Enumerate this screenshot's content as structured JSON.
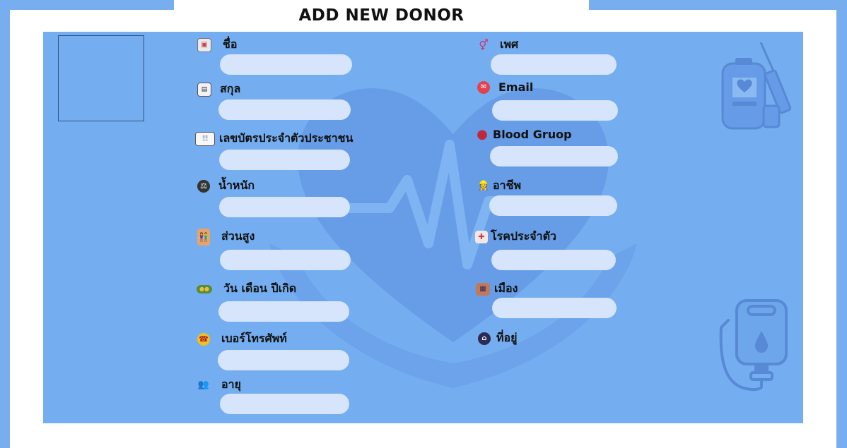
{
  "header": {
    "title": "ADD NEW DONOR"
  },
  "left_fields": [
    {
      "label": "ชื่อ",
      "icon": "id-badge-icon",
      "value": "",
      "placeholder": ""
    },
    {
      "label": "สกุล",
      "icon": "id-card-icon",
      "value": "",
      "placeholder": ""
    },
    {
      "label": "เลขบัตรประจำตัวประชาชน",
      "icon": "citizen-card-icon",
      "value": "",
      "placeholder": ""
    },
    {
      "label": "น้ำหนัก",
      "icon": "weight-scale-icon",
      "value": "",
      "placeholder": ""
    },
    {
      "label": "ส่วนสูง",
      "icon": "people-height-icon",
      "value": "",
      "placeholder": ""
    },
    {
      "label": "วัน เดือน ปีเกิด",
      "icon": "birthday-icon",
      "value": "",
      "placeholder": ""
    },
    {
      "label": "เบอร์โทรศัพท์",
      "icon": "phone-icon",
      "value": "",
      "placeholder": ""
    },
    {
      "label": "อายุ",
      "icon": "age-people-icon",
      "value": "",
      "placeholder": ""
    }
  ],
  "right_fields": [
    {
      "label": "เพศ",
      "icon": "gender-icon",
      "value": "",
      "placeholder": ""
    },
    {
      "label": "Email",
      "icon": "email-icon",
      "value": "",
      "placeholder": ""
    },
    {
      "label": "Blood Gruop",
      "icon": "blood-drop-icon",
      "value": "",
      "placeholder": ""
    },
    {
      "label": "อาชีพ",
      "icon": "occupation-icon",
      "value": "",
      "placeholder": ""
    },
    {
      "label": "โรคประจำตัว",
      "icon": "medical-condition-icon",
      "value": "",
      "placeholder": ""
    },
    {
      "label": "เมือง",
      "icon": "city-icon",
      "value": "",
      "placeholder": ""
    },
    {
      "label": "ที่อยู่",
      "icon": "home-location-icon"
    }
  ],
  "colors": {
    "panel": "#75aef0",
    "input": "#d6e5fb",
    "accent": "#e0434f"
  }
}
